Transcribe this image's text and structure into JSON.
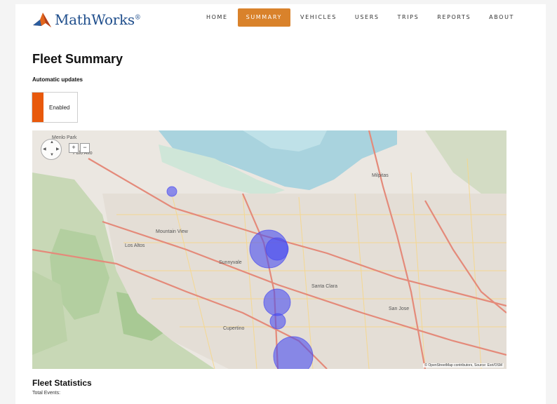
{
  "brand": {
    "name": "MathWorks",
    "reg": "®"
  },
  "nav": {
    "items": [
      "HOME",
      "SUMMARY",
      "VEHICLES",
      "USERS",
      "TRIPS",
      "REPORTS",
      "ABOUT"
    ],
    "active": "SUMMARY"
  },
  "page": {
    "title": "Fleet Summary"
  },
  "updates": {
    "label": "Automatic updates",
    "status": "Enabled"
  },
  "map": {
    "places": [
      "Menlo Park",
      "Palo Alto",
      "Mountain View",
      "Los Altos",
      "Sunnyvale",
      "Santa Clara",
      "San Jose",
      "Cupertino",
      "Milpitas"
    ],
    "zoom_in": "+",
    "zoom_out": "−",
    "attribution": "© OpenStreetMap contributors, Source: Esri/OSM"
  },
  "stats": {
    "title": "Fleet Statistics",
    "total_events_label": "Total Events:"
  },
  "colors": {
    "accent": "#d9822b",
    "toggle": "#e8590c",
    "marker": "#4a4cf0"
  }
}
